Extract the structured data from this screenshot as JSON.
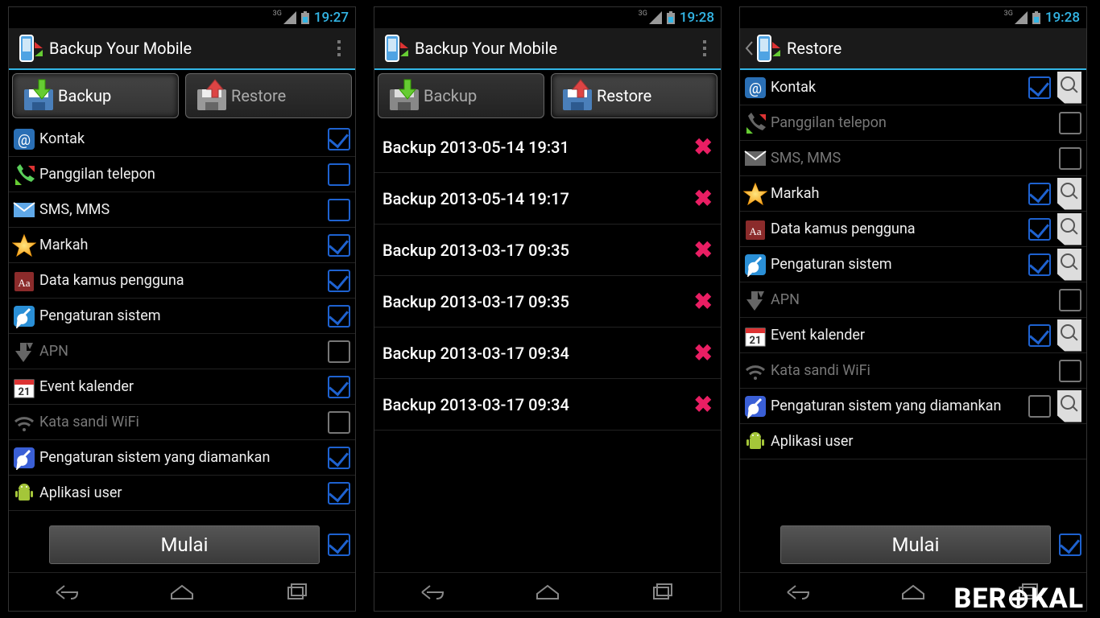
{
  "screens": [
    {
      "id": "backup",
      "status": {
        "time": "19:27",
        "net": "3G"
      },
      "actionbar": {
        "title": "Backup Your Mobile",
        "overflow": true,
        "back": false
      },
      "tabs": {
        "backup": "Backup",
        "restore": "Restore",
        "active": "backup"
      },
      "items": [
        {
          "key": "contacts",
          "label": "Kontak",
          "checked": true,
          "dim": false
        },
        {
          "key": "calls",
          "label": "Panggilan telepon",
          "checked": false,
          "dim": false
        },
        {
          "key": "sms",
          "label": "SMS, MMS",
          "checked": false,
          "dim": false
        },
        {
          "key": "bookmarks",
          "label": "Markah",
          "checked": true,
          "dim": false
        },
        {
          "key": "dict",
          "label": "Data kamus pengguna",
          "checked": true,
          "dim": false
        },
        {
          "key": "settings",
          "label": "Pengaturan sistem",
          "checked": true,
          "dim": false
        },
        {
          "key": "apn",
          "label": "APN",
          "checked": false,
          "dim": true,
          "gray": true
        },
        {
          "key": "calendar",
          "label": "Event kalender",
          "checked": true,
          "dim": false
        },
        {
          "key": "wifi",
          "label": "Kata sandi WiFi",
          "checked": false,
          "dim": true,
          "gray": true
        },
        {
          "key": "secset",
          "label": "Pengaturan sistem yang diamankan",
          "checked": true,
          "dim": false
        },
        {
          "key": "apps",
          "label": "Aplikasi user",
          "checked": true,
          "dim": false
        }
      ],
      "bottom": {
        "start": "Mulai",
        "allChecked": true
      }
    },
    {
      "id": "restore-list",
      "status": {
        "time": "19:28",
        "net": "3G"
      },
      "actionbar": {
        "title": "Backup Your Mobile",
        "overflow": true,
        "back": false
      },
      "tabs": {
        "backup": "Backup",
        "restore": "Restore",
        "active": "restore"
      },
      "backups": [
        "Backup 2013-05-14 19:31",
        "Backup 2013-05-14 19:17",
        "Backup 2013-03-17 09:35",
        "Backup 2013-03-17 09:35",
        "Backup 2013-03-17 09:34",
        "Backup 2013-03-17 09:34"
      ]
    },
    {
      "id": "restore-detail",
      "status": {
        "time": "19:28",
        "net": "3G"
      },
      "actionbar": {
        "title": "Restore",
        "overflow": false,
        "back": true
      },
      "items": [
        {
          "key": "contacts",
          "label": "Kontak",
          "checked": true,
          "dim": false,
          "mag": true
        },
        {
          "key": "calls",
          "label": "Panggilan telepon",
          "checked": false,
          "dim": true,
          "gray": true
        },
        {
          "key": "sms",
          "label": "SMS, MMS",
          "checked": false,
          "dim": true,
          "gray": true
        },
        {
          "key": "bookmarks",
          "label": "Markah",
          "checked": true,
          "dim": false,
          "mag": true
        },
        {
          "key": "dict",
          "label": "Data kamus pengguna",
          "checked": true,
          "dim": false,
          "mag": true
        },
        {
          "key": "settings",
          "label": "Pengaturan sistem",
          "checked": true,
          "dim": false,
          "mag": true
        },
        {
          "key": "apn",
          "label": "APN",
          "checked": false,
          "dim": true,
          "gray": true
        },
        {
          "key": "calendar",
          "label": "Event kalender",
          "checked": true,
          "dim": false,
          "mag": true
        },
        {
          "key": "wifi",
          "label": "Kata sandi WiFi",
          "checked": false,
          "dim": true,
          "gray": true
        },
        {
          "key": "secset",
          "label": "Pengaturan sistem yang diamankan",
          "checked": false,
          "dim": false,
          "gray": true,
          "mag": true
        },
        {
          "key": "apps",
          "label": "Aplikasi user",
          "checked": null,
          "dim": false
        }
      ],
      "bottom": {
        "start": "Mulai",
        "allChecked": true
      }
    }
  ],
  "watermark": "BER⊕KAL"
}
